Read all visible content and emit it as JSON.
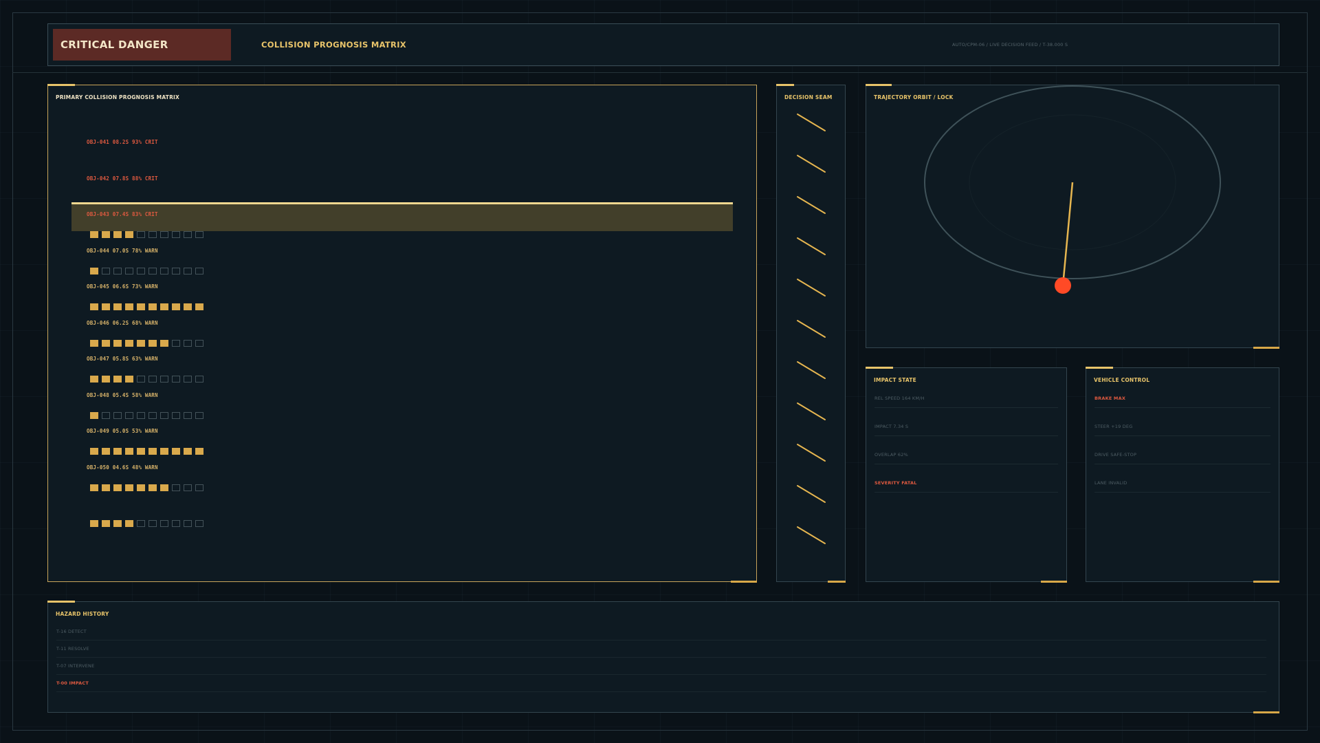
{
  "header": {
    "alert_label": "CRITICAL DANGER",
    "title": "COLLISION PROGNOSIS MATRIX",
    "meta": "AUTO/CPM-06  /  LIVE DECISION FEED  /  T-38.000 S"
  },
  "matrix": {
    "title": "PRIMARY COLLISION PROGNOSIS MATRIX",
    "rows": [
      {
        "label": "OBJ-041  08.2S  93%  CRIT",
        "level": "crit"
      },
      {
        "label": "OBJ-042  07.8S  88%  CRIT",
        "level": "crit"
      },
      {
        "label": "OBJ-043  07.4S  83%  CRIT",
        "level": "crit"
      },
      {
        "label": "OBJ-044  07.0S  78%  WARN",
        "level": "warn"
      },
      {
        "label": "OBJ-045  06.6S  73%  WARN",
        "level": "warn"
      },
      {
        "label": "OBJ-046  06.2S  68%  WARN",
        "level": "warn"
      },
      {
        "label": "OBJ-047  05.8S  63%  WARN",
        "level": "warn"
      },
      {
        "label": "OBJ-048  05.4S  58%  WARN",
        "level": "warn"
      },
      {
        "label": "OBJ-049  05.0S  53%  WARN",
        "level": "warn"
      },
      {
        "label": "OBJ-050  04.6S  48%  WARN",
        "level": "warn"
      }
    ],
    "bars_filled": [
      4,
      1,
      10,
      7,
      4,
      1,
      10,
      7,
      4
    ],
    "bar_segments": 10,
    "selected_row": 2
  },
  "seam": {
    "title": "DECISION SEAM"
  },
  "trajectory": {
    "title": "TRAJECTORY ORBIT / LOCK"
  },
  "impact": {
    "title": "IMPACT STATE",
    "items": [
      {
        "text": "REL SPEED 164 KM/H",
        "alert": false
      },
      {
        "text": "IMPACT 7.34 S",
        "alert": false
      },
      {
        "text": "OVERLAP 62%",
        "alert": false
      },
      {
        "text": "SEVERITY FATAL",
        "alert": true
      }
    ]
  },
  "vehicle": {
    "title": "VEHICLE CONTROL",
    "items": [
      {
        "text": "BRAKE MAX",
        "alert": true
      },
      {
        "text": "STEER +19 DEG",
        "alert": false
      },
      {
        "text": "DRIVE SAFE-STOP",
        "alert": false
      },
      {
        "text": "LANE INVALID",
        "alert": false
      }
    ]
  },
  "history": {
    "title": "HAZARD HISTORY",
    "items": [
      {
        "text": "T-16 DETECT",
        "alert": false
      },
      {
        "text": "T-11 RESOLVE",
        "alert": false
      },
      {
        "text": "T-07 INTERVENE",
        "alert": false
      },
      {
        "text": "T-00 IMPACT",
        "alert": true
      }
    ]
  },
  "colors": {
    "accent": "#e8c46a",
    "critical": "#e05a40",
    "danger_bg": "#5c2a25",
    "panel_bg": "#0e1a22"
  }
}
